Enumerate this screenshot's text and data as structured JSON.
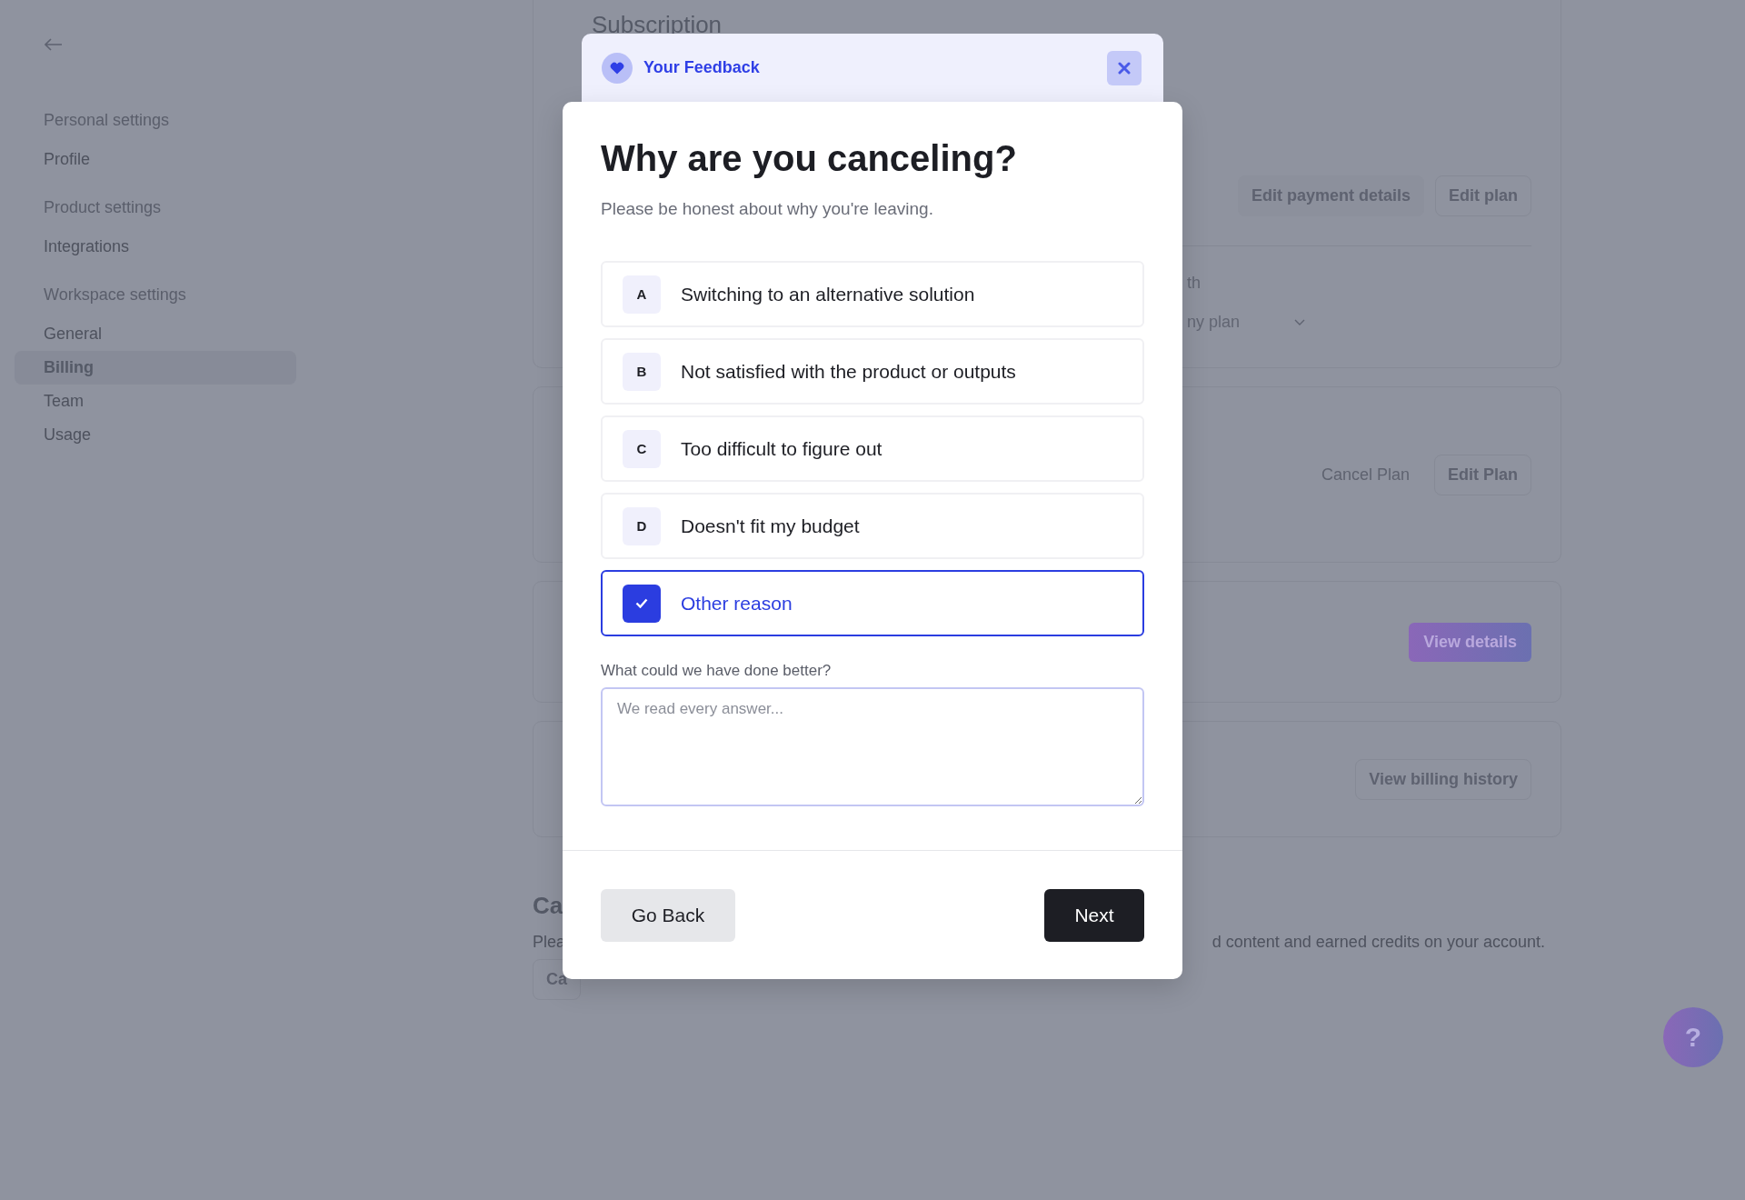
{
  "sidebar": {
    "sections": [
      {
        "heading": "Personal settings",
        "items": [
          {
            "label": "Profile",
            "selected": false
          }
        ]
      },
      {
        "heading": "Product settings",
        "items": [
          {
            "label": "Integrations",
            "selected": false
          }
        ]
      },
      {
        "heading": "Workspace settings",
        "items": [
          {
            "label": "General",
            "selected": false
          },
          {
            "label": "Billing",
            "selected": true
          },
          {
            "label": "Team",
            "selected": false
          },
          {
            "label": "Usage",
            "selected": false
          }
        ]
      }
    ]
  },
  "background": {
    "subscription": {
      "heading": "Subscription",
      "buttons": [
        "Edit payment details",
        "Edit plan"
      ],
      "text_fragment": "th",
      "select_fragment": "ny plan"
    },
    "plan_card": {
      "buttons": [
        {
          "label": "Cancel Plan",
          "disabled": true
        },
        {
          "label": "Edit Plan",
          "disabled": false
        }
      ]
    },
    "details_card": {
      "button": "View details"
    },
    "billing_card": {
      "button": "View billing history"
    },
    "cancel_section": {
      "heading_fragment": "Ca",
      "text_fragments": [
        "Plea",
        "d content and earned credits on your account."
      ],
      "button_fragment": "Ca"
    }
  },
  "modal": {
    "header": "Your Feedback",
    "title": "Why are you canceling?",
    "subtitle": "Please be honest about why you're leaving.",
    "options": [
      {
        "key": "A",
        "label": "Switching to an alternative solution",
        "selected": false
      },
      {
        "key": "B",
        "label": "Not satisfied with the product or outputs",
        "selected": false
      },
      {
        "key": "C",
        "label": "Too difficult to figure out",
        "selected": false
      },
      {
        "key": "D",
        "label": "Doesn't fit my budget",
        "selected": false
      },
      {
        "label": "Other reason",
        "selected": true
      }
    ],
    "feedback": {
      "label": "What could we have done better?",
      "placeholder": "We read every answer..."
    },
    "back_button": "Go Back",
    "next_button": "Next"
  },
  "help_button": "?"
}
